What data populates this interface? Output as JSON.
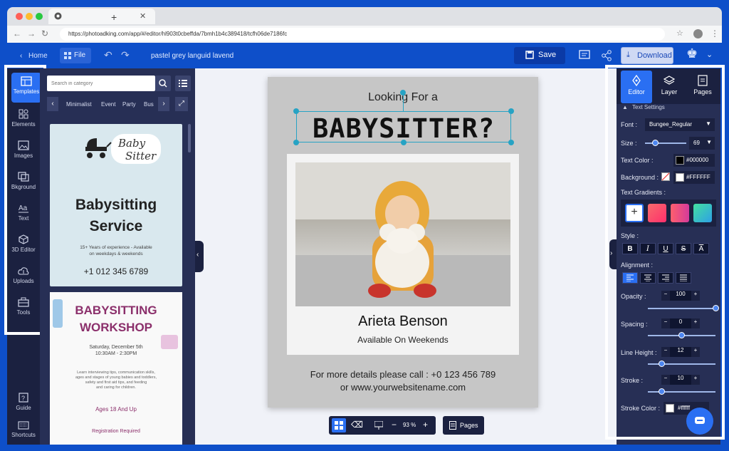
{
  "browser": {
    "url": "https://photoadking.com/app/#/editor/hl903t0cbeffda/7bmh1b4c389418/tcfh06de7186fc"
  },
  "header": {
    "home": "Home",
    "file": "File",
    "doc_title": "pastel grey languid lavend",
    "save": "Save",
    "download": "Download"
  },
  "rail": {
    "items": [
      {
        "label": "Templates"
      },
      {
        "label": "Elements"
      },
      {
        "label": "Images"
      },
      {
        "label": "Bkground"
      },
      {
        "label": "Text"
      },
      {
        "label": "3D Editor"
      },
      {
        "label": "Uploads"
      },
      {
        "label": "Tools"
      }
    ],
    "guide": "Guide",
    "shortcuts": "Shortcuts"
  },
  "templates": {
    "search_placeholder": "Search in category",
    "categories": [
      "Minimalist",
      "Event",
      "Party",
      "Bus"
    ],
    "card1": {
      "logo_line1": "Baby",
      "logo_line2": "Sitter",
      "title_line1": "Babysitting",
      "title_line2": "Service",
      "desc_line1": "15+ Years of experience - Available",
      "desc_line2": "on weekdays & weekends",
      "phone": "+1 012 345 6789"
    },
    "card2": {
      "title_line1": "BABYSITTING",
      "title_line2": "WORKSHOP",
      "date_line1": "Saturday, December 5th",
      "date_line2": "10:30AM - 2:30PM",
      "desc_line1": "Learn interviewing tips, communication skills,",
      "desc_line2": "ages and stages of young babies and toddlers,",
      "desc_line3": "safety and first aid tips, and feeding",
      "desc_line4": "and caring for children.",
      "ages": "Ages 18 And Up",
      "reg": "Registration Required"
    }
  },
  "poster": {
    "top": "Looking For a",
    "title": "BABYSITTER?",
    "name": "Arieta Benson",
    "sub": "Available On Weekends",
    "foot1": "For more details please call : +0 123 456 789",
    "foot2": "or www.yourwebsitename.com"
  },
  "toolbar": {
    "zoom": "93 %",
    "pages": "Pages"
  },
  "editor": {
    "tabs": [
      {
        "label": "Editor"
      },
      {
        "label": "Layer"
      },
      {
        "label": "Pages"
      }
    ],
    "section": "Text Settings",
    "font_label": "Font :",
    "font_value": "Bungee_Regular",
    "size_label": "Size :",
    "size_value": "69",
    "text_color_label": "Text Color :",
    "text_color": "#000000",
    "background_label": "Background :",
    "background_color": "#FFFFFF",
    "gradients_label": "Text Gradients :",
    "style_label": "Style :",
    "alignment_label": "Alignment :",
    "opacity_label": "Opacity :",
    "opacity": "100",
    "opacity_level": 1.0,
    "spacing_label": "Spacing :",
    "spacing": "0",
    "spacing_level": 0.5,
    "line_height_label": "Line Height :",
    "line_height": "12",
    "line_height_level": 0.2,
    "stroke_label": "Stroke :",
    "stroke": "10",
    "stroke_level": 0.2,
    "stroke_color_label": "Stroke Color :",
    "stroke_color": "#ffffff"
  },
  "colors": {
    "accent": "#2a6ff2",
    "header": "#0e4fc9",
    "panel": "#272f55"
  }
}
